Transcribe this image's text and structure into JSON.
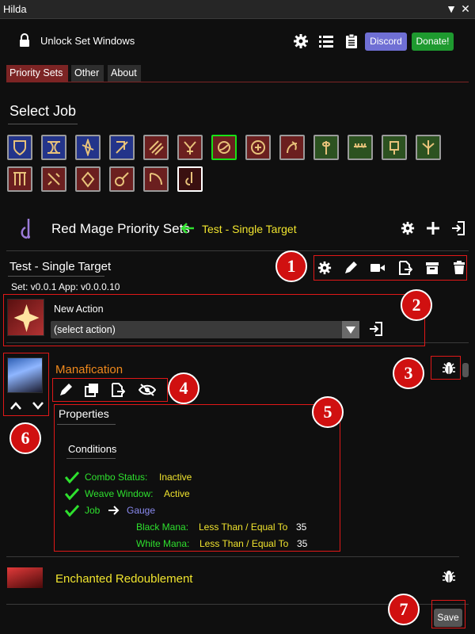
{
  "window": {
    "title": "Hilda"
  },
  "toolbar": {
    "unlock_label": "Unlock Set Windows",
    "discord_label": "Discord",
    "donate_label": "Donate!"
  },
  "tabs": [
    {
      "label": "Priority Sets",
      "active": true
    },
    {
      "label": "Other",
      "active": false
    },
    {
      "label": "About",
      "active": false
    }
  ],
  "select_job": {
    "heading": "Select Job"
  },
  "priority": {
    "job_title": "Red Mage Priority Sets",
    "current_set": "Test - Single Target"
  },
  "set": {
    "name": "Test - Single Target",
    "version": "Set: v0.0.1  App: v0.0.0.10"
  },
  "new_action": {
    "label": "New Action",
    "select_value": "(select action)"
  },
  "action1": {
    "name": "Manafication",
    "properties_title": "Properties",
    "conditions_title": "Conditions",
    "conditions": [
      {
        "label": "Combo Status:",
        "value": "Inactive"
      },
      {
        "label": "Weave Window:",
        "value": "Active"
      }
    ],
    "job_condition": {
      "label": "Job",
      "target": "Gauge",
      "gauges": [
        {
          "label": "Black Mana:",
          "comparison": "Less Than / Equal To",
          "value": "35"
        },
        {
          "label": "White Mana:",
          "comparison": "Less Than / Equal To",
          "value": "35"
        }
      ]
    }
  },
  "action2": {
    "name": "Enchanted Redoublement"
  },
  "footer": {
    "save_label": "Save"
  },
  "annotations": [
    "1",
    "2",
    "3",
    "4",
    "5",
    "6",
    "7"
  ],
  "colors": {
    "accent_red": "#7c2424",
    "annotation_red": "#d01010",
    "selected_job": "#18e018",
    "condition_green": "#2ee02e",
    "value_yellow": "#f0e42e",
    "gauge_purple": "#8a8af0",
    "action_orange": "#f0891c"
  }
}
